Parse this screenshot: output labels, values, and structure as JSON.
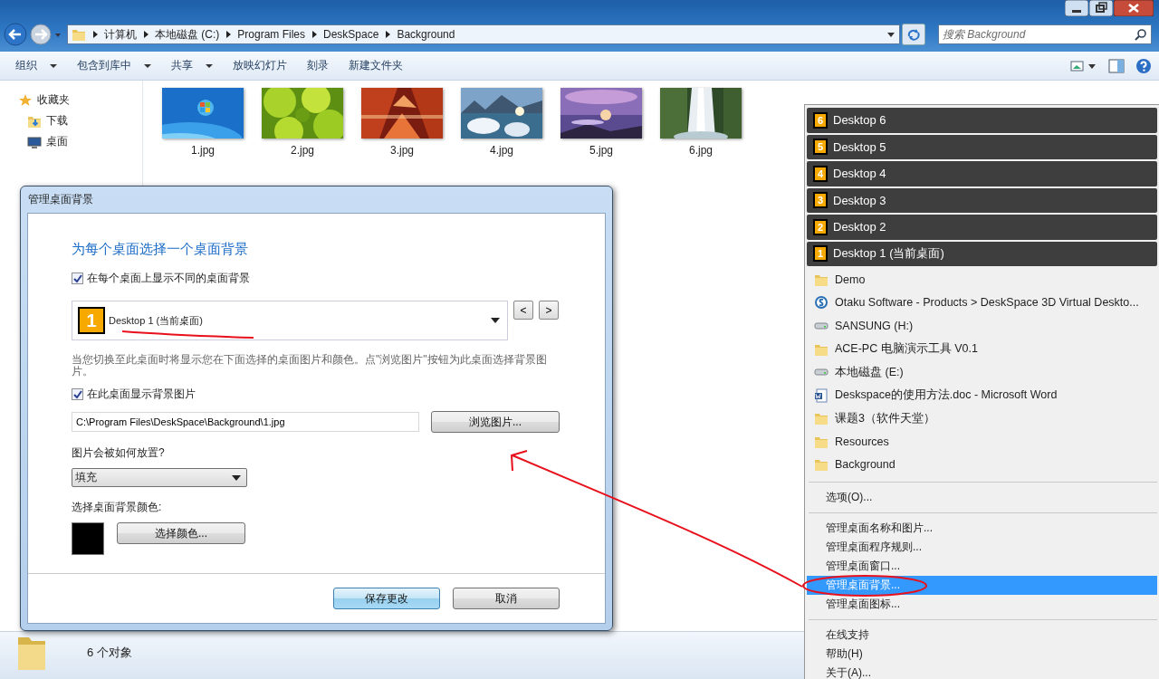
{
  "explorer": {
    "breadcrumb": [
      "计算机",
      "本地磁盘 (C:)",
      "Program Files",
      "DeskSpace",
      "Background"
    ],
    "search": {
      "placeholder": "搜索 Background"
    },
    "toolbar": [
      {
        "label": "组织",
        "dropdown": true
      },
      {
        "label": "包含到库中",
        "dropdown": true
      },
      {
        "label": "共享",
        "dropdown": true
      },
      {
        "label": "放映幻灯片",
        "dropdown": false
      },
      {
        "label": "刻录",
        "dropdown": false
      },
      {
        "label": "新建文件夹",
        "dropdown": false
      }
    ],
    "sidebar": [
      {
        "kind": "star",
        "label": "收藏夹",
        "children": [
          {
            "kind": "download",
            "label": "下载"
          },
          {
            "kind": "desktop",
            "label": "桌面"
          }
        ]
      }
    ],
    "files": [
      {
        "name": "1.jpg",
        "kind": "picture"
      },
      {
        "name": "2.jpg",
        "kind": "picture"
      },
      {
        "name": "3.jpg",
        "kind": "picture"
      },
      {
        "name": "4.jpg",
        "kind": "picture"
      },
      {
        "name": "5.jpg",
        "kind": "picture"
      },
      {
        "name": "6.jpg",
        "kind": "picture"
      }
    ],
    "status": "6 个对象"
  },
  "dialog": {
    "title": "管理桌面背景",
    "heading": "为每个桌面选择一个桌面背景",
    "different_backgrounds": {
      "label": "在每个桌面上显示不同的桌面背景",
      "checked": true
    },
    "desktop_select": {
      "badge": "1",
      "value": "Desktop 1 (当前桌面)"
    },
    "prev_button": "<",
    "next_button": ">",
    "description": "当您切换至此桌面时将显示您在下面选择的桌面图片和颜色。点\"浏览图片\"按钮为此桌面选择背景图片。",
    "show_picture": {
      "label": "在此桌面显示背景图片",
      "checked": true
    },
    "path": "C:\\Program Files\\DeskSpace\\Background\\1.jpg",
    "browse_button": "浏览图片...",
    "placement_label": "图片会被如何放置?",
    "placement": "填充",
    "color_label": "选择桌面背景颜色:",
    "color": "#000000",
    "color_button": "选择颜色...",
    "buttons": [
      {
        "label": "保存更改",
        "default": true
      },
      {
        "label": "取消",
        "default": false
      }
    ]
  },
  "menu": {
    "items": [
      {
        "kind": "desktop",
        "badge": "6",
        "label": "Desktop 6"
      },
      {
        "kind": "desktop",
        "badge": "5",
        "label": "Desktop 5"
      },
      {
        "kind": "desktop",
        "badge": "4",
        "label": "Desktop 4"
      },
      {
        "kind": "desktop",
        "badge": "3",
        "label": "Desktop 3"
      },
      {
        "kind": "desktop",
        "badge": "2",
        "label": "Desktop 2"
      },
      {
        "kind": "desktop",
        "badge": "1",
        "label": "Desktop 1 (当前桌面)"
      },
      {
        "kind": "folder",
        "label": "Demo"
      },
      {
        "kind": "web",
        "label": "Otaku Software - Products > DeskSpace 3D Virtual Deskto..."
      },
      {
        "kind": "drive",
        "label": "SANSUNG (H:)"
      },
      {
        "kind": "folder",
        "label": "ACE-PC 电脑演示工具 V0.1"
      },
      {
        "kind": "drive",
        "label": "本地磁盘 (E:)"
      },
      {
        "kind": "word",
        "label": "Deskspace的使用方法.doc - Microsoft Word"
      },
      {
        "kind": "folder",
        "label": "课题3（软件天堂）"
      },
      {
        "kind": "folder",
        "label": "Resources"
      },
      {
        "kind": "folder",
        "label": "Background"
      },
      {
        "kind": "separator"
      },
      {
        "kind": "command",
        "label": "选项(O)...",
        "selected": false
      },
      {
        "kind": "separator"
      },
      {
        "kind": "command",
        "label": "管理桌面名称和图片...",
        "selected": false
      },
      {
        "kind": "command",
        "label": "管理桌面程序规则...",
        "selected": false
      },
      {
        "kind": "command",
        "label": "管理桌面窗口...",
        "selected": false
      },
      {
        "kind": "command",
        "label": "管理桌面背景...",
        "selected": true
      },
      {
        "kind": "command",
        "label": "管理桌面图标...",
        "selected": false
      },
      {
        "kind": "separator"
      },
      {
        "kind": "command",
        "label": "在线支持",
        "selected": false
      },
      {
        "kind": "command",
        "label": "帮助(H)",
        "selected": false
      },
      {
        "kind": "command",
        "label": "关于(A)...",
        "selected": false
      }
    ]
  }
}
